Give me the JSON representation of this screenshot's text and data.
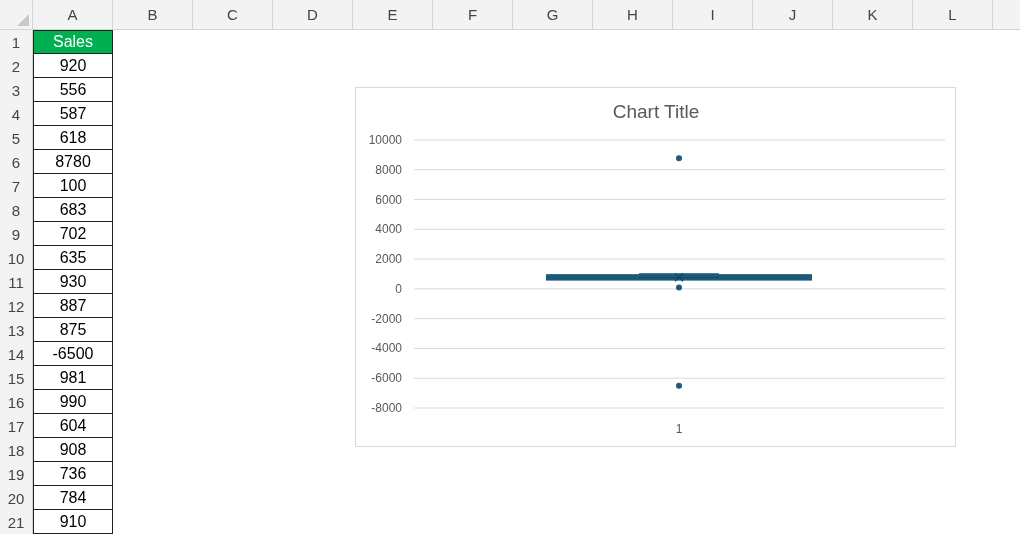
{
  "sheet": {
    "columns": [
      "A",
      "B",
      "C",
      "D",
      "E",
      "F",
      "G",
      "H",
      "I",
      "J",
      "K",
      "L"
    ],
    "rows": [
      {
        "number": "1",
        "kind": "header",
        "value": "Sales"
      },
      {
        "number": "2",
        "kind": "value",
        "value": "920"
      },
      {
        "number": "3",
        "kind": "value",
        "value": "556"
      },
      {
        "number": "4",
        "kind": "value",
        "value": "587"
      },
      {
        "number": "5",
        "kind": "value",
        "value": "618"
      },
      {
        "number": "6",
        "kind": "value",
        "value": "8780"
      },
      {
        "number": "7",
        "kind": "value",
        "value": "100"
      },
      {
        "number": "8",
        "kind": "value",
        "value": "683"
      },
      {
        "number": "9",
        "kind": "value",
        "value": "702"
      },
      {
        "number": "10",
        "kind": "value",
        "value": "635"
      },
      {
        "number": "11",
        "kind": "value",
        "value": "930"
      },
      {
        "number": "12",
        "kind": "value",
        "value": "887"
      },
      {
        "number": "13",
        "kind": "value",
        "value": "875"
      },
      {
        "number": "14",
        "kind": "value",
        "value": "-6500"
      },
      {
        "number": "15",
        "kind": "value",
        "value": "981"
      },
      {
        "number": "16",
        "kind": "value",
        "value": "990"
      },
      {
        "number": "17",
        "kind": "value",
        "value": "604"
      },
      {
        "number": "18",
        "kind": "value",
        "value": "908"
      },
      {
        "number": "19",
        "kind": "value",
        "value": "736"
      },
      {
        "number": "20",
        "kind": "value",
        "value": "784"
      },
      {
        "number": "21",
        "kind": "value",
        "value": "910"
      }
    ]
  },
  "chart": {
    "title": "Chart Title",
    "y_axis_labels": [
      "10000",
      "8000",
      "6000",
      "4000",
      "2000",
      "0",
      "-2000",
      "-4000",
      "-6000",
      "-8000"
    ],
    "x_axis_labels": [
      "1"
    ]
  }
}
